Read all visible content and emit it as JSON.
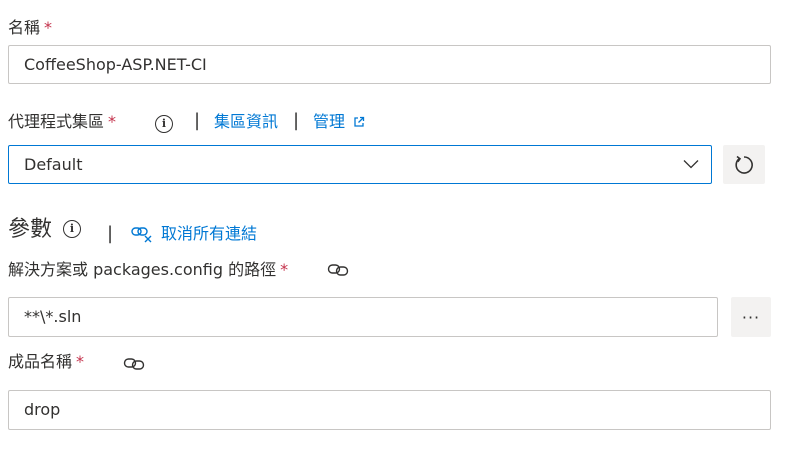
{
  "name_field": {
    "label": "名稱",
    "required_mark": "*",
    "value": "CoffeeShop-ASP.NET-CI"
  },
  "agent_pool": {
    "label": "代理程式集區",
    "required_mark": "*",
    "separator": "|",
    "pool_info_link": "集區資訊",
    "manage_link": "管理",
    "selected_value": "Default",
    "icons": {
      "info": "info-icon",
      "external": "external-link-icon",
      "dropdown": "chevron-down-icon",
      "refresh": "refresh-icon"
    }
  },
  "parameters": {
    "title": "參數",
    "separator": "|",
    "unlink_all_label": "取消所有連結",
    "icons": {
      "info": "info-icon",
      "unlink": "unlink-icon"
    }
  },
  "solution_path": {
    "label": "解決方案或 packages.config 的路徑",
    "required_mark": "*",
    "value": "**\\*.sln",
    "browse_label": "···",
    "icons": {
      "link": "link-icon"
    }
  },
  "artifact_name": {
    "label": "成品名稱",
    "required_mark": "*",
    "value": "drop",
    "icons": {
      "link": "link-icon"
    }
  },
  "colors": {
    "accent": "#0078d4",
    "required": "#c4314b",
    "border": "#c8c6c4",
    "text": "#323130"
  }
}
